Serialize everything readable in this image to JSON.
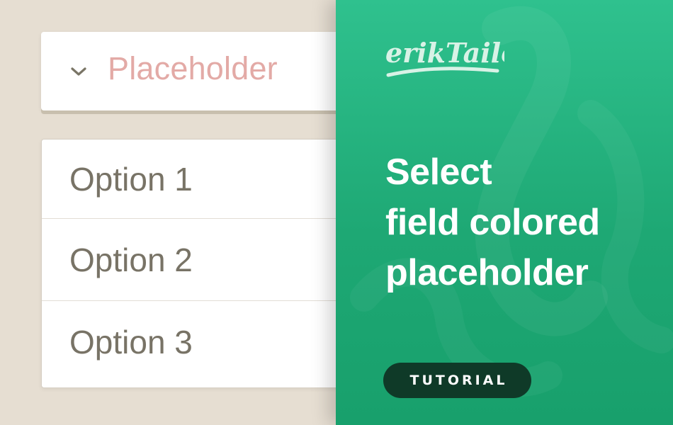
{
  "select": {
    "placeholder": "Placeholder",
    "placeholder_color": "#e3aaa6",
    "icon": "chevron-down-icon"
  },
  "options": [
    {
      "label": "Option 1"
    },
    {
      "label": "Option 2"
    },
    {
      "label": "Option 3"
    }
  ],
  "panel": {
    "brand": "erikTailor",
    "headline_lines": [
      "Select",
      "field colored",
      "placeholder"
    ],
    "badge": "TUTORIAL",
    "accent_color": "#23b07e",
    "badge_color": "#0f3a28"
  }
}
